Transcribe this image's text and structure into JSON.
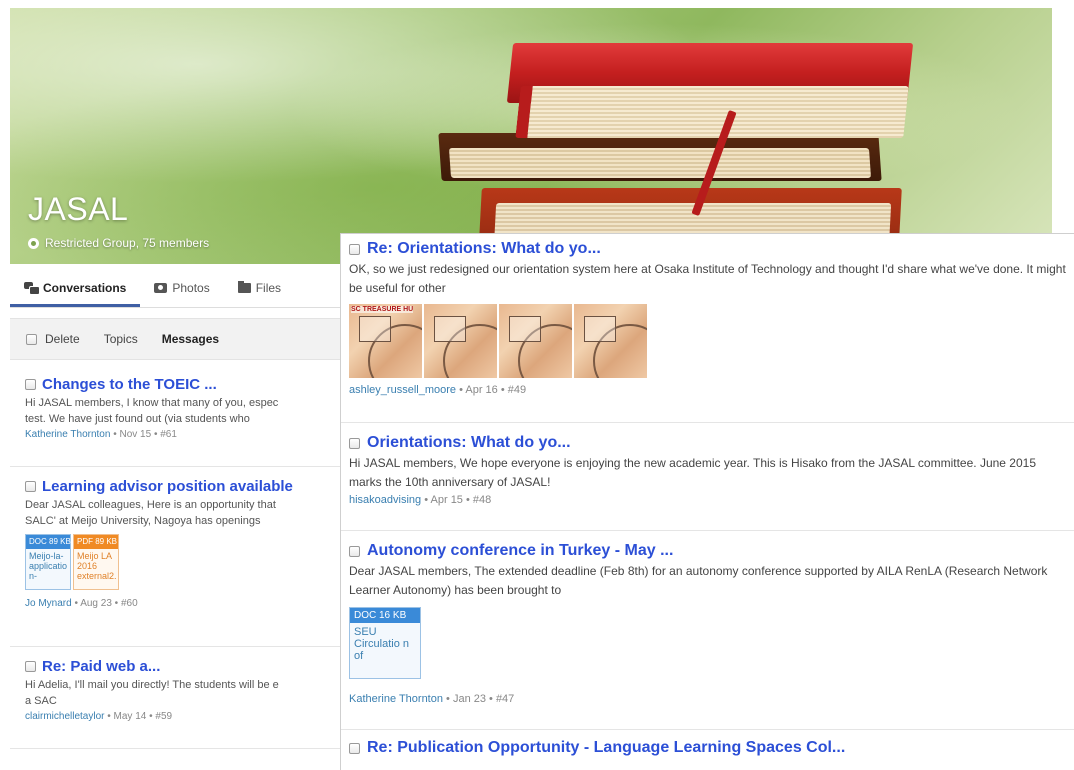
{
  "group": {
    "name": "JASAL",
    "meta": "Restricted Group, 75 members"
  },
  "tabs": [
    {
      "label": "Conversations",
      "icon": "chat-icon"
    },
    {
      "label": "Photos",
      "icon": "camera-icon"
    },
    {
      "label": "Files",
      "icon": "folder-icon"
    }
  ],
  "toolbar": {
    "delete_label": "Delete",
    "topics_label": "Topics",
    "messages_label": "Messages"
  },
  "left_messages": [
    {
      "title": "Changes to the TOEIC ...",
      "body_lines": [
        "Hi JASAL members, I know that many of you, espec",
        "test. We have just found out (via students who"
      ],
      "author": "Katherine Thornton",
      "meta": "• Nov 15 • #61"
    },
    {
      "title": "Learning advisor position available",
      "body_lines": [
        "Dear JASAL colleagues, Here is an opportunity that",
        "SALC' at Meijo University, Nagoya has openings"
      ],
      "attachments": [
        {
          "type": "DOC",
          "size_label": "DOC 89 KB",
          "name": "Meijo-la-applicatio n-"
        },
        {
          "type": "PDF",
          "size_label": "PDF 89 KB",
          "name": "Meijo LA 2016 external2."
        }
      ],
      "author": "Jo Mynard",
      "meta": "• Aug 23 • #60"
    },
    {
      "title": "Re: Paid web a...",
      "body_lines": [
        "Hi Adelia, I'll mail you directly! The students will be e",
        "a SAC"
      ],
      "author": "clairmichelletaylor",
      "meta": "• May 14 • #59"
    }
  ],
  "panel_messages": [
    {
      "title": "Re: Orientations: What do yo...",
      "body": "OK, so we just redesigned our orientation system here at Osaka Institute of Technology and thought I'd share what we've done. It might be useful for other",
      "photo_caption": "SC TREASURE HU",
      "author": "ashley_russell_moore",
      "meta": "• Apr 16 • #49"
    },
    {
      "title": "Orientations: What do yo...",
      "body": "Hi JASAL members, We hope everyone is enjoying the new academic year. This is Hisako from the JASAL committee. June 2015 marks the 10th anniversary of JASAL!",
      "author": "hisakoadvising",
      "meta": "• Apr 15 • #48"
    },
    {
      "title": "Autonomy conference in Turkey - May ...",
      "body": "Dear JASAL members, The extended deadline (Feb 8th) for an autonomy conference supported by AILA RenLA (Research Network Learner Autonomy) has been brought to",
      "attachment": {
        "size_label": "DOC 16 KB",
        "name": "SEU Circulatio n of"
      },
      "author": "Katherine Thornton",
      "meta": "• Jan 23 • #47"
    },
    {
      "title": "Re: Publication Opportunity - Language Learning Spaces Col..."
    }
  ],
  "colors": {
    "link_blue": "#2c4fd6",
    "author_blue": "#3a7fb0",
    "tab_underline": "#3f5fa4",
    "doc_badge": "#3a8ad8",
    "pdf_badge": "#f08a24"
  }
}
